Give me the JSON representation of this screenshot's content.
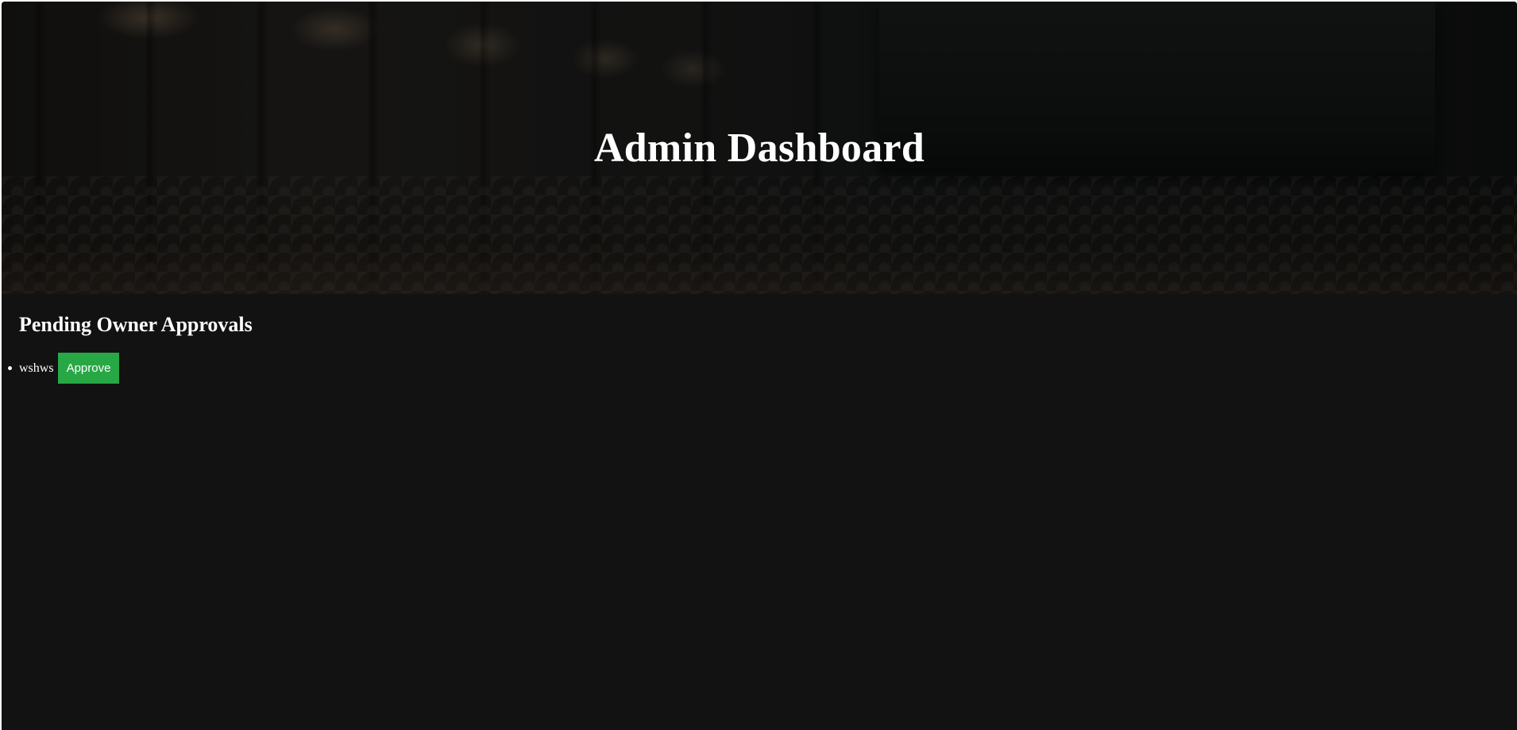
{
  "header": {
    "title": "Admin Dashboard"
  },
  "main": {
    "section_title": "Pending Owner Approvals",
    "pending_owners": [
      {
        "name": "wshws",
        "action_label": "Approve"
      }
    ]
  },
  "colors": {
    "page_background": "#121212",
    "approve_button": "#28a745",
    "text": "#ffffff"
  }
}
